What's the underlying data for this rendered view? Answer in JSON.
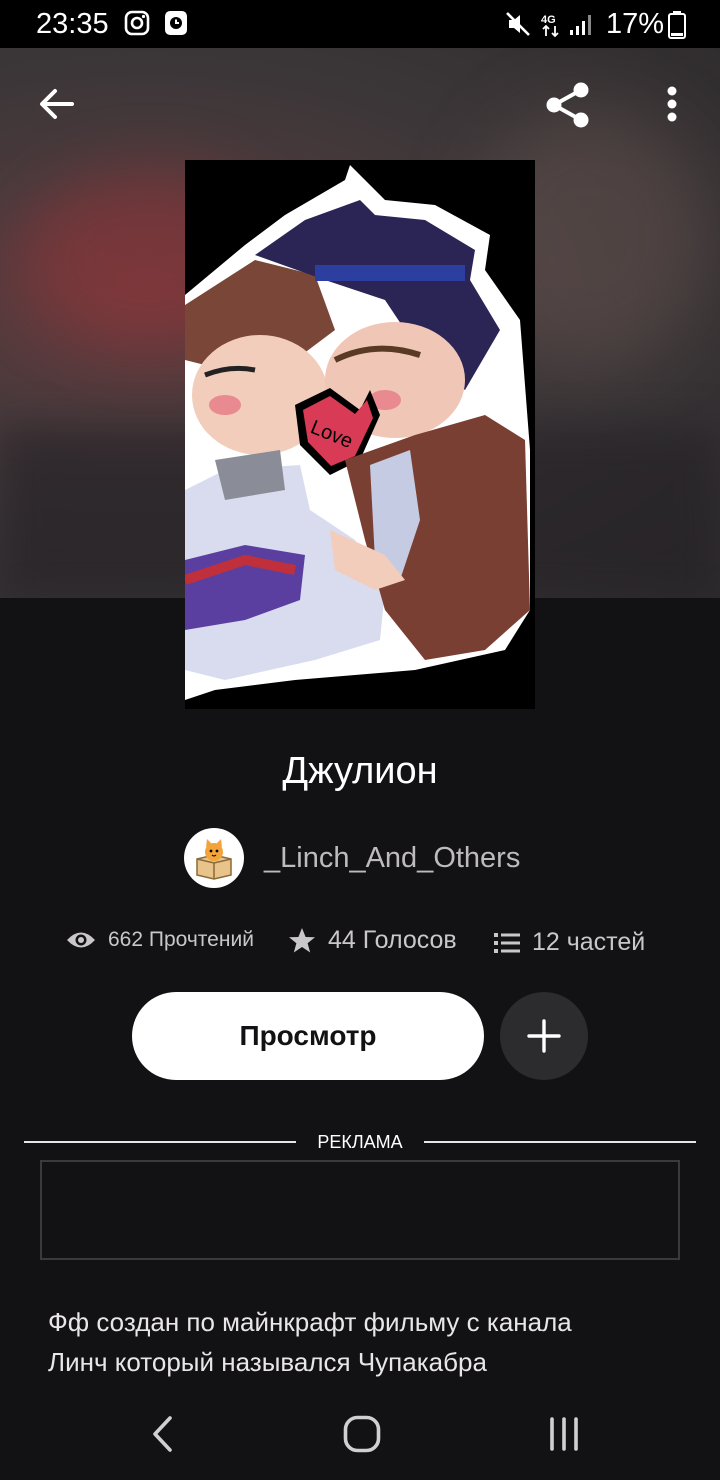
{
  "status_bar": {
    "time": "23:35",
    "network": "4G",
    "battery": "17%",
    "icons": [
      "instagram-icon",
      "clock-app-icon",
      "mute-icon",
      "network-4g-icon",
      "signal-icon",
      "battery-icon"
    ]
  },
  "toolbar": {
    "back_icon": "arrow-left-icon",
    "share_icon": "share-icon",
    "menu_icon": "more-vertical-icon"
  },
  "story": {
    "title": "Джулион",
    "author": "_Linch_And_Others",
    "cover_text": "Love"
  },
  "stats": {
    "reads": "662 Прочтений",
    "votes": "44 Голосов",
    "parts": "12 частей"
  },
  "actions": {
    "read_label": "Просмотр",
    "add_icon": "plus-icon"
  },
  "ad": {
    "label": "РЕКЛАМА"
  },
  "description": {
    "line1": "Фф создан по майнкрафт фильму с канала",
    "line2": "Линч который назывался Чупакабра"
  },
  "colors": {
    "background": "#121113",
    "button_white": "#ffffff",
    "add_button": "#2c2b2e",
    "stat_text": "#c9c7cb"
  }
}
